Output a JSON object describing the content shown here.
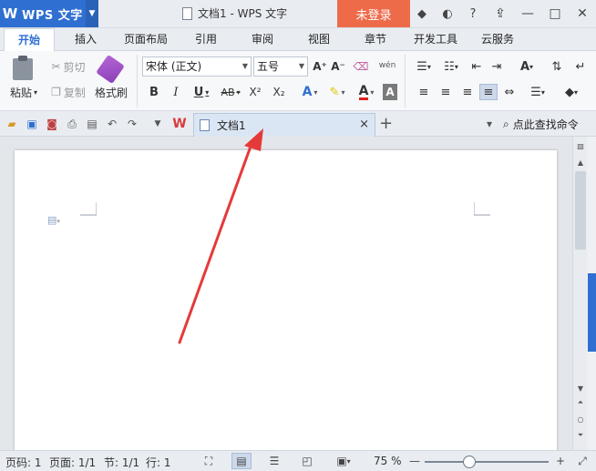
{
  "app": {
    "logo": "W",
    "name": "WPS 文字"
  },
  "window": {
    "document_title": "文档1 - WPS 文字",
    "login_label": "未登录",
    "help_label": "?"
  },
  "menu": {
    "tabs": [
      "开始",
      "插入",
      "页面布局",
      "引用",
      "审阅",
      "视图",
      "章节",
      "开发工具",
      "云服务"
    ],
    "active": "开始"
  },
  "ribbon": {
    "paste_label": "粘贴",
    "cut_label": "剪切",
    "copy_label": "复制",
    "format_painter_label": "格式刷",
    "font_name": "宋体 (正文)",
    "font_size": "五号",
    "bold": "B",
    "italic": "I",
    "underline": "U",
    "strike": "AB",
    "superscript": "X²",
    "subscript": "X₂",
    "text_effect": "A",
    "font_color": "A",
    "pinyin": "wén",
    "grow": "A⁺",
    "shrink": "A⁻"
  },
  "doc_tab": {
    "label": "文档1",
    "close": "×"
  },
  "command_search": "点此查找命令",
  "status": {
    "page": "页码: 1",
    "pages": "页面: 1/1",
    "section": "节: 1/1",
    "line": "行: 1",
    "zoom": "75 %",
    "zoom_level": 75
  },
  "colors": {
    "brand": "#2f6fd1",
    "login": "#ee6b4a",
    "annotation": "#e53a3a"
  }
}
